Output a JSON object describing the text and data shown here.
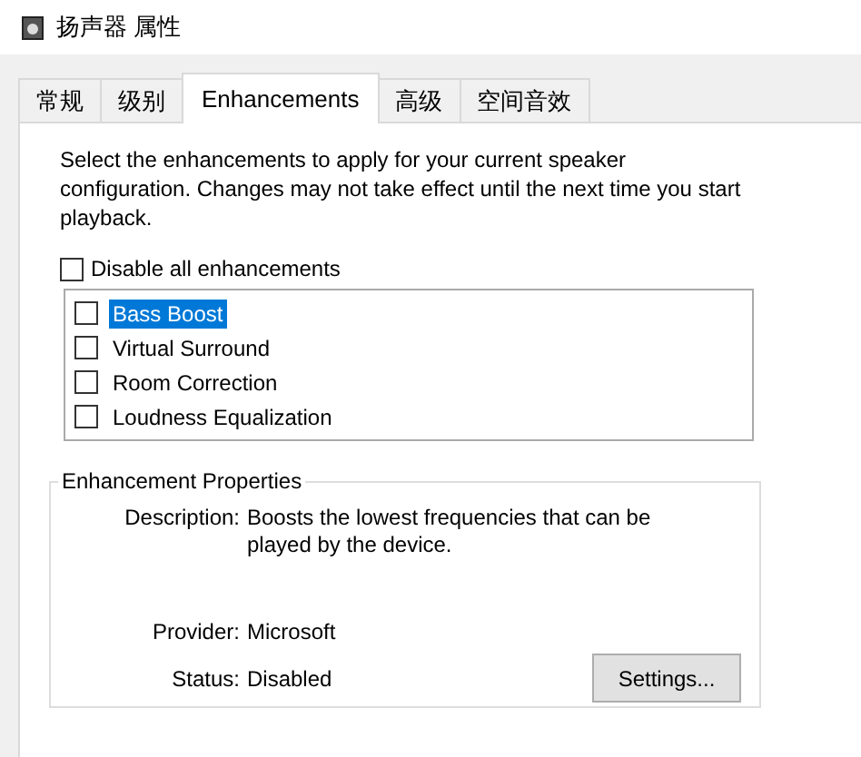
{
  "window": {
    "title": "扬声器 属性"
  },
  "tabs": [
    {
      "label": "常规",
      "selected": false
    },
    {
      "label": "级别",
      "selected": false
    },
    {
      "label": "Enhancements",
      "selected": true
    },
    {
      "label": "高级",
      "selected": false
    },
    {
      "label": "空间音效",
      "selected": false
    }
  ],
  "intro": "Select the enhancements to apply for your current speaker configuration. Changes may not take effect until the next time you start playback.",
  "disable_all": {
    "label": "Disable all enhancements",
    "checked": false
  },
  "enhancements": [
    {
      "label": "Bass Boost",
      "checked": false,
      "selected": true
    },
    {
      "label": "Virtual Surround",
      "checked": false,
      "selected": false
    },
    {
      "label": "Room Correction",
      "checked": false,
      "selected": false
    },
    {
      "label": "Loudness Equalization",
      "checked": false,
      "selected": false
    }
  ],
  "properties": {
    "title": "Enhancement Properties",
    "fields": [
      {
        "label": "Description:",
        "value": "Boosts the lowest frequencies that can be played by the device."
      },
      {
        "label": "Provider:",
        "value": "Microsoft"
      },
      {
        "label": "Status:",
        "value": "Disabled"
      }
    ],
    "settings_button": "Settings..."
  }
}
